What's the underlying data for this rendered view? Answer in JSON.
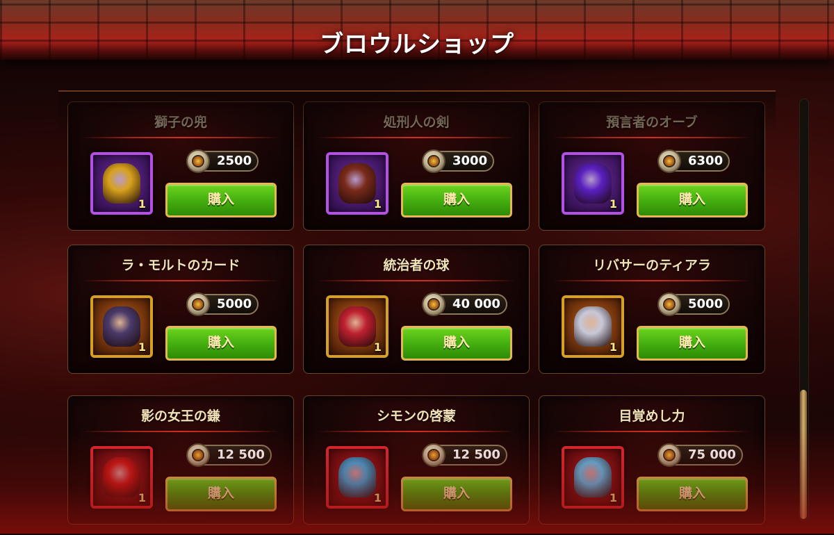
{
  "title": "ブロウルショップ",
  "buy_label": "購入",
  "items": [
    {
      "name": "獅子の兜",
      "price": "2500",
      "qty": "1",
      "rarity": "purple",
      "art_color": "#d9a21c",
      "icon": "lion-helmet-icon"
    },
    {
      "name": "処刑人の剣",
      "price": "3000",
      "qty": "1",
      "rarity": "purple",
      "art_color": "#7a2a1a",
      "icon": "crossbow-sword-icon"
    },
    {
      "name": "預言者のオーブ",
      "price": "6300",
      "qty": "1",
      "rarity": "purple",
      "art_color": "#5a20c0",
      "icon": "orb-icon"
    },
    {
      "name": "ラ・モルトのカード",
      "price": "5000",
      "qty": "1",
      "rarity": "gold",
      "art_color": "#4a3a6a",
      "icon": "card-icon"
    },
    {
      "name": "統治者の球",
      "price": "40 000",
      "qty": "1",
      "rarity": "gold",
      "art_color": "#c02030",
      "icon": "sphere-icon"
    },
    {
      "name": "リバサーのティアラ",
      "price": "5000",
      "qty": "1",
      "rarity": "gold",
      "art_color": "#c8c8d8",
      "icon": "tiara-icon"
    },
    {
      "name": "影の女王の鎌",
      "price": "12 500",
      "qty": "1",
      "rarity": "red",
      "art_color": "#d01818",
      "icon": "scythe-icon"
    },
    {
      "name": "シモンの啓蒙",
      "price": "12 500",
      "qty": "1",
      "rarity": "red",
      "art_color": "#40a8e0",
      "icon": "head-icon"
    },
    {
      "name": "目覚めし力",
      "price": "75 000",
      "qty": "1",
      "rarity": "red",
      "art_color": "#60c0f0",
      "icon": "power-orb-icon"
    }
  ]
}
